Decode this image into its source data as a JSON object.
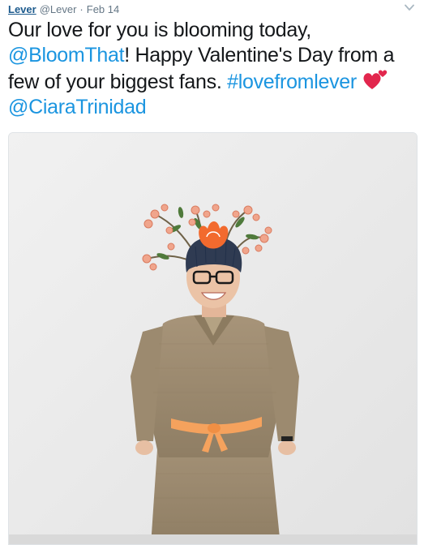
{
  "tweet": {
    "author_name": "Lever",
    "author_handle": "@Lever",
    "separator": "·",
    "date": "Feb 14",
    "text_line1": "Our love for you is blooming today,",
    "mention1": "@BloomThat",
    "text_line2_rest": "! Happy Valentine's Day from a",
    "text_line3": "few of your biggest fans.",
    "hashtag": "#lovefromlever",
    "mention2": "@CiaraTrinidad",
    "emoji": "two-hearts-emoji"
  },
  "media": {
    "type": "photo",
    "subject": "person in burlap costume with flower headdress"
  },
  "icons": {
    "menu": "chevron-down-icon"
  },
  "colors": {
    "author_link": "#1c5a8d",
    "meta_gray": "#657786",
    "link_blue": "#1b95e0",
    "text": "#14171a",
    "heart": "#e2264d",
    "wall": "#ededed",
    "burlap": "#a08e73",
    "ribbon": "#f5a25d"
  }
}
